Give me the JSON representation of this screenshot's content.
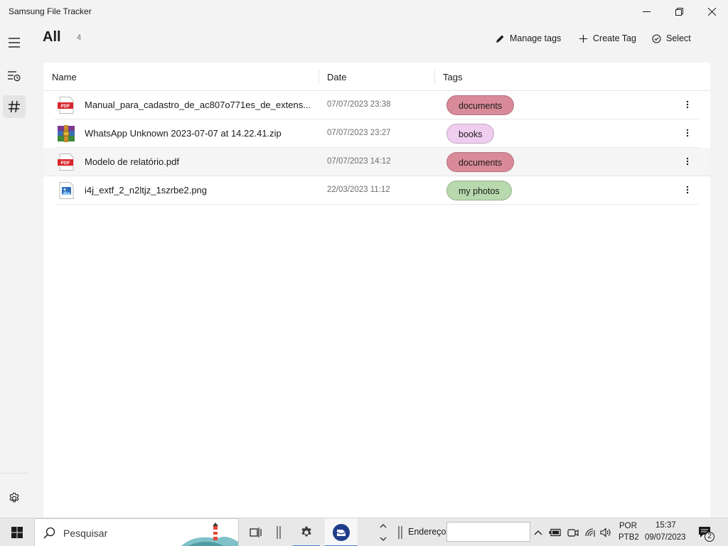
{
  "window": {
    "title": "Samsung File Tracker"
  },
  "header": {
    "title": "All",
    "count": "4",
    "manage_tags": "Manage tags",
    "create_tag": "Create Tag",
    "select": "Select"
  },
  "table": {
    "columns": {
      "name": "Name",
      "date": "Date",
      "tags": "Tags"
    },
    "rows": [
      {
        "name": "Manual_para_cadastro_de_ac807o771es_de_extens...",
        "date": "07/07/2023 23:38",
        "tag": "documents",
        "tag_color": "#d98a98",
        "icon": "pdf-icon"
      },
      {
        "name": "WhatsApp Unknown 2023-07-07 at 14.22.41.zip",
        "date": "07/07/2023 23:27",
        "tag": "books",
        "tag_color": "#efcdef",
        "icon": "winrar-archive-icon"
      },
      {
        "name": "Modelo de relatório.pdf",
        "date": "07/07/2023 14:12",
        "tag": "documents",
        "tag_color": "#d98a98",
        "icon": "pdf-icon"
      },
      {
        "name": "i4j_extf_2_n2ltjz_1szrbe2.png",
        "date": "22/03/2023 11:12",
        "tag": "my photos",
        "tag_color": "#b7d9ad",
        "icon": "image-file-icon"
      }
    ]
  },
  "taskbar": {
    "search_placeholder": "Pesquisar",
    "address_label": "Endereço",
    "language": "POR",
    "keyboard": "PTB2",
    "time": "15:37",
    "date": "09/07/2023",
    "notifications": "2"
  },
  "colors": {
    "accent": "#4a7bd0",
    "pdf_red": "#d9262c"
  }
}
